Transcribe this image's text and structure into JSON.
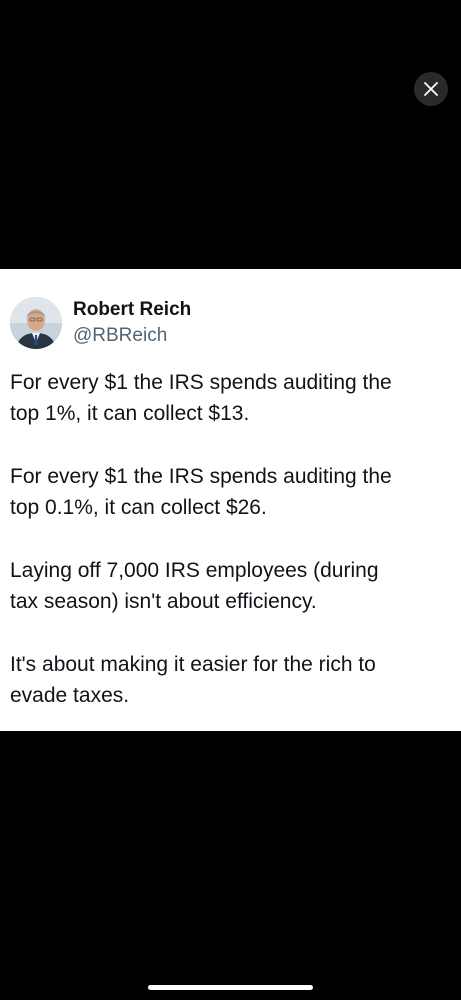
{
  "viewer": {
    "close_icon": "close-icon",
    "background_color": "#000000"
  },
  "tweet": {
    "author": {
      "display_name": "Robert Reich",
      "handle": "@RBReich",
      "avatar_icon": "avatar-photo"
    },
    "paragraphs": [
      {
        "line1": "For every $1 the IRS spends auditing the",
        "line2": "top 1%, it can collect $13."
      },
      {
        "line1": "For every $1 the IRS spends auditing the",
        "line2": "top 0.1%, it can collect $26."
      },
      {
        "line1": "Laying off 7,000 IRS employees (during",
        "line2": "tax season) isn't about efficiency."
      },
      {
        "line1": "It's about making it easier for the rich to",
        "line2": "evade taxes."
      }
    ],
    "card_color": "#ffffff",
    "text_color": "#0f1419",
    "handle_color": "#536471"
  },
  "system": {
    "home_indicator": "home-indicator"
  }
}
